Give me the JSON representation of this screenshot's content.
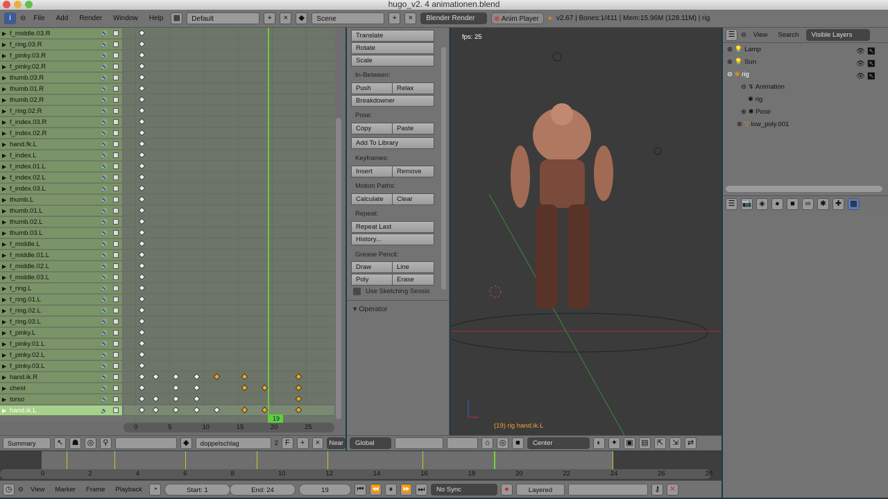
{
  "window": {
    "title": "hugo_v2. 4 animationen.blend"
  },
  "topbar": {
    "menus": [
      "File",
      "Add",
      "Render",
      "Window",
      "Help"
    ],
    "layout": "Default",
    "scene": "Scene",
    "engine": "Blender Render",
    "anim_player": "Anim Player",
    "stats": "v2.67 | Bones:1/411  | Mem:15.96M (128.11M) | rig"
  },
  "dopesheet": {
    "channels": [
      {
        "name": "f_middle.03.R",
        "keys": [
          [
            1,
            0
          ]
        ]
      },
      {
        "name": "f_ring.03.R",
        "keys": [
          [
            1,
            0
          ]
        ]
      },
      {
        "name": "f_pinky.03.R",
        "keys": [
          [
            1,
            0
          ]
        ]
      },
      {
        "name": "f_pinky.02.R",
        "keys": [
          [
            1,
            0
          ]
        ]
      },
      {
        "name": "thumb.03.R",
        "keys": [
          [
            1,
            0
          ]
        ]
      },
      {
        "name": "thumb.01.R",
        "keys": [
          [
            1,
            0
          ]
        ]
      },
      {
        "name": "thumb.02.R",
        "keys": [
          [
            1,
            0
          ]
        ]
      },
      {
        "name": "f_ring.02.R",
        "keys": [
          [
            1,
            0
          ]
        ]
      },
      {
        "name": "f_index.03.R",
        "keys": [
          [
            1,
            0
          ]
        ]
      },
      {
        "name": "f_index.02.R",
        "keys": [
          [
            1,
            0
          ]
        ]
      },
      {
        "name": "hand.fk.L",
        "keys": [
          [
            1,
            0
          ]
        ]
      },
      {
        "name": "f_index.L",
        "keys": [
          [
            1,
            0
          ]
        ]
      },
      {
        "name": "f_index.01.L",
        "keys": [
          [
            1,
            0
          ]
        ]
      },
      {
        "name": "f_index.02.L",
        "keys": [
          [
            1,
            0
          ]
        ]
      },
      {
        "name": "f_index.03.L",
        "keys": [
          [
            1,
            0
          ]
        ]
      },
      {
        "name": "thumb.L",
        "keys": [
          [
            1,
            0
          ]
        ]
      },
      {
        "name": "thumb.01.L",
        "keys": [
          [
            1,
            0
          ]
        ]
      },
      {
        "name": "thumb.02.L",
        "keys": [
          [
            1,
            0
          ]
        ]
      },
      {
        "name": "thumb.03.L",
        "keys": [
          [
            1,
            0
          ]
        ]
      },
      {
        "name": "f_middle.L",
        "keys": [
          [
            1,
            0
          ]
        ]
      },
      {
        "name": "f_middle.01.L",
        "keys": [
          [
            1,
            0
          ]
        ]
      },
      {
        "name": "f_middle.02.L",
        "keys": [
          [
            1,
            0
          ]
        ]
      },
      {
        "name": "f_middle.03.L",
        "keys": [
          [
            1,
            0
          ]
        ]
      },
      {
        "name": "f_ring.L",
        "keys": [
          [
            1,
            0
          ]
        ]
      },
      {
        "name": "f_ring.01.L",
        "keys": [
          [
            1,
            0
          ]
        ]
      },
      {
        "name": "f_ring.02.L",
        "keys": [
          [
            1,
            0
          ]
        ]
      },
      {
        "name": "f_ring.03.L",
        "keys": [
          [
            1,
            0
          ]
        ]
      },
      {
        "name": "f_pinky.L",
        "keys": [
          [
            1,
            0
          ]
        ]
      },
      {
        "name": "f_pinky.01.L",
        "keys": [
          [
            1,
            0
          ]
        ]
      },
      {
        "name": "f_pinky.02.L",
        "keys": [
          [
            1,
            0
          ]
        ]
      },
      {
        "name": "f_pinky.03.L",
        "keys": [
          [
            1,
            0
          ]
        ]
      },
      {
        "name": "hand.ik.R",
        "keys": [
          [
            1,
            0
          ],
          [
            3,
            0
          ],
          [
            6,
            0
          ],
          [
            9,
            0
          ],
          [
            12,
            1
          ],
          [
            16,
            1
          ],
          [
            24,
            1
          ]
        ]
      },
      {
        "name": "chest",
        "keys": [
          [
            1,
            0
          ],
          [
            6,
            0
          ],
          [
            9,
            0
          ],
          [
            16,
            1
          ],
          [
            19,
            1
          ],
          [
            24,
            1
          ]
        ]
      },
      {
        "name": "torso",
        "keys": [
          [
            1,
            0
          ],
          [
            3,
            0
          ],
          [
            6,
            0
          ],
          [
            9,
            0
          ],
          [
            24,
            1
          ]
        ]
      },
      {
        "name": "hand.ik.L",
        "selected": true,
        "keys": [
          [
            1,
            0
          ],
          [
            3,
            0
          ],
          [
            6,
            0
          ],
          [
            9,
            0
          ],
          [
            12,
            0
          ],
          [
            16,
            1
          ],
          [
            19,
            1
          ],
          [
            24,
            1
          ]
        ]
      }
    ],
    "ruler": [
      "0",
      "5",
      "10",
      "15",
      "20",
      "25"
    ],
    "current_frame": "19",
    "header": {
      "mode": "Summary",
      "action": "doppelschlag",
      "users": "2",
      "fake": "F",
      "snap": "Near"
    }
  },
  "toolshelf": {
    "transform": [
      "Translate",
      "Rotate",
      "Scale"
    ],
    "inbetween_label": "In-Between:",
    "push": "Push",
    "relax": "Relax",
    "breakdowner": "Breakdowner",
    "pose_label": "Pose:",
    "copy": "Copy",
    "paste": "Paste",
    "add_library": "Add To Library",
    "keyframes_label": "Keyframes:",
    "insert": "Insert",
    "remove": "Remove",
    "motion_label": "Motion Paths:",
    "calculate": "Calculate",
    "clear": "Clear",
    "repeat_label": "Repeat:",
    "repeat_last": "Repeat Last",
    "history": "History...",
    "grease_label": "Grease Pencil:",
    "draw": "Draw",
    "line": "Line",
    "poly": "Poly",
    "erase": "Erase",
    "sketching": "Use Sketching Sessio",
    "operator": "Operator"
  },
  "viewport": {
    "fps": "fps: 25",
    "object_label": "(19) rig hand.ik.L",
    "orientation": "Global",
    "pivot": "Center"
  },
  "outliner": {
    "view": "View",
    "search": "Search",
    "filter": "Visible Layers",
    "items": [
      {
        "name": "Lamp"
      },
      {
        "name": "Sun"
      },
      {
        "name": "rig"
      },
      {
        "name": "Animation"
      },
      {
        "name": "rig"
      },
      {
        "name": "Pose"
      },
      {
        "name": "low_poly.001"
      }
    ]
  },
  "timeline": {
    "menus": [
      "View",
      "Marker",
      "Frame",
      "Playback"
    ],
    "start": "Start: 1",
    "end": "End: 24",
    "frame": "19",
    "sync": "No Sync",
    "keying": "Layered",
    "ruler": [
      "0",
      "2",
      "4",
      "6",
      "8",
      "10",
      "12",
      "14",
      "16",
      "18",
      "20",
      "22",
      "24",
      "26",
      "28"
    ],
    "markers": [
      1,
      3,
      6,
      9,
      12,
      16,
      24
    ],
    "current": 19
  }
}
